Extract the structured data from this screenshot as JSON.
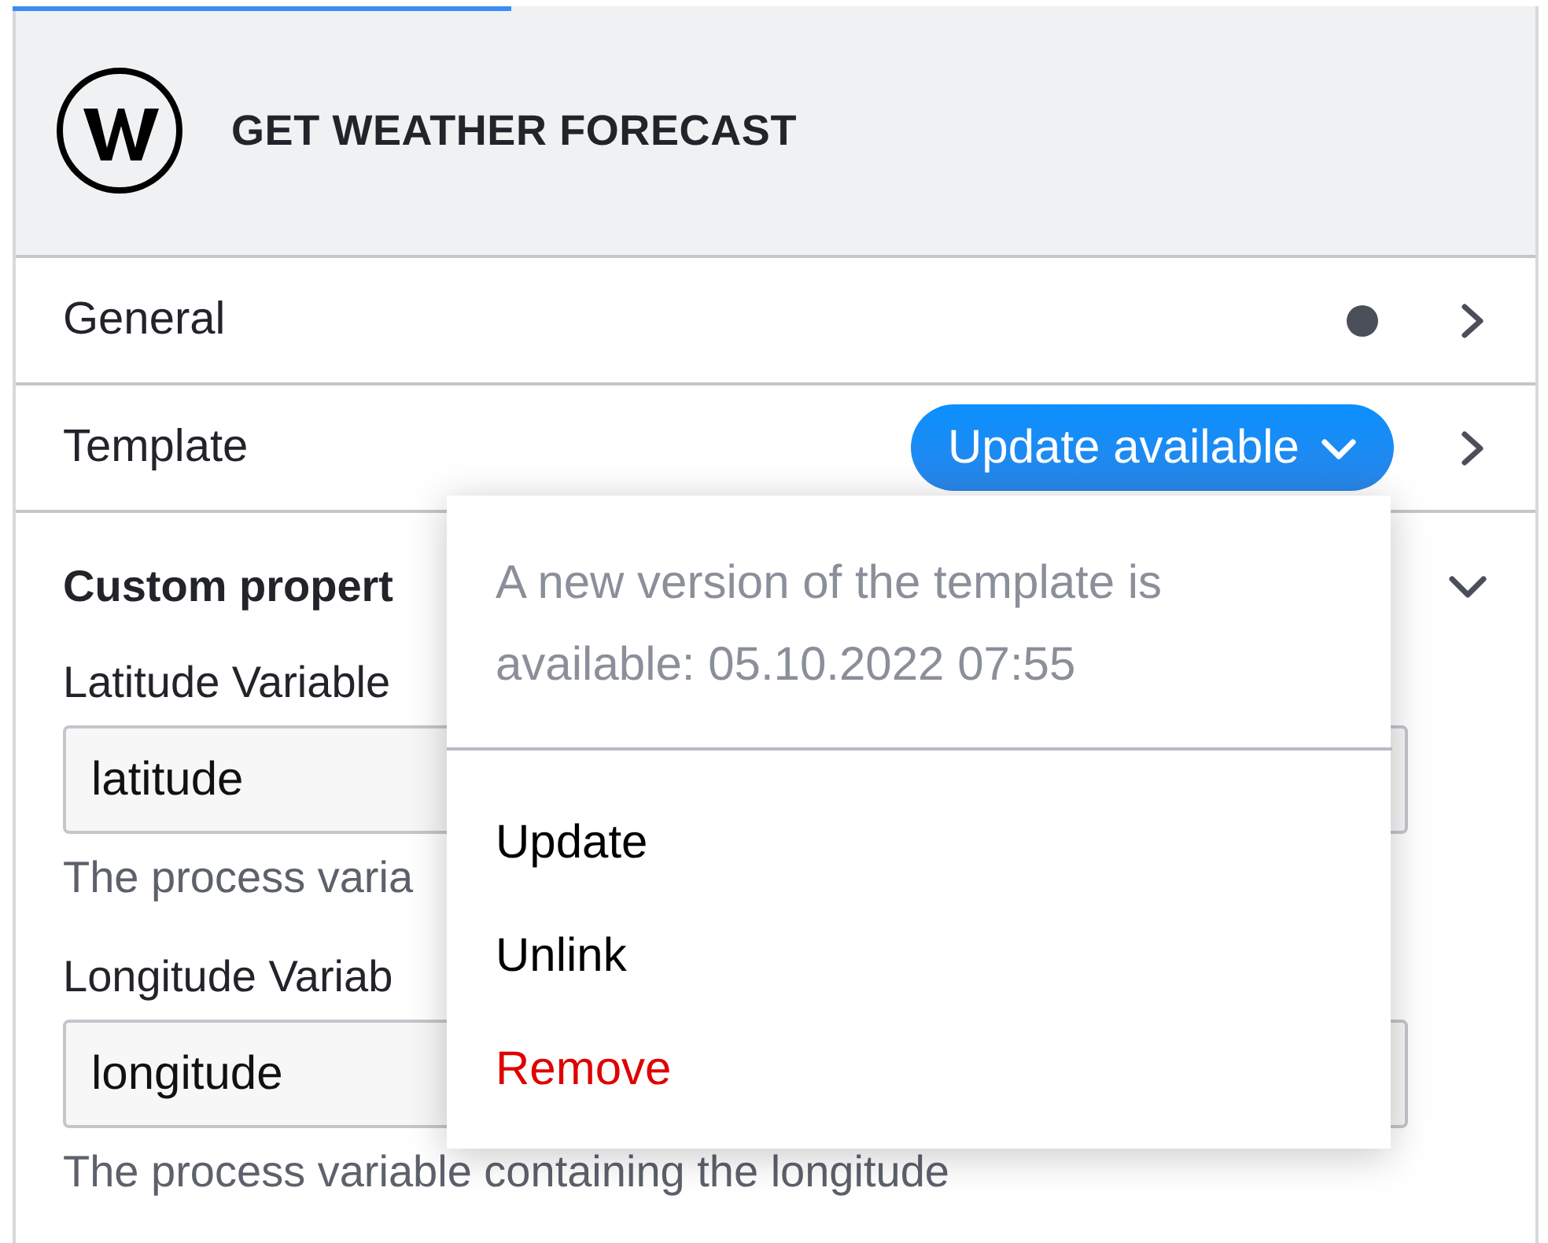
{
  "header": {
    "title": "GET WEATHER FORECAST"
  },
  "sections": [
    {
      "title": "General",
      "modified": true,
      "expanded": false
    },
    {
      "title": "Template",
      "expanded": false,
      "badge": {
        "label": "Update available",
        "open": true
      }
    },
    {
      "title": "Custom propert",
      "expanded": true,
      "fields": [
        {
          "label": "Latitude Variable",
          "value": "latitude",
          "hint": "The process varia"
        },
        {
          "label": "Longitude Variab",
          "value": "longitude",
          "hint": "The process variable containing the longitude"
        }
      ]
    }
  ],
  "template_menu": {
    "description": "A new version of the template is available: 05.10.2022 07:55",
    "items": [
      {
        "label": "Update",
        "kind": "normal"
      },
      {
        "label": "Unlink",
        "kind": "normal"
      },
      {
        "label": "Remove",
        "kind": "danger"
      }
    ]
  }
}
